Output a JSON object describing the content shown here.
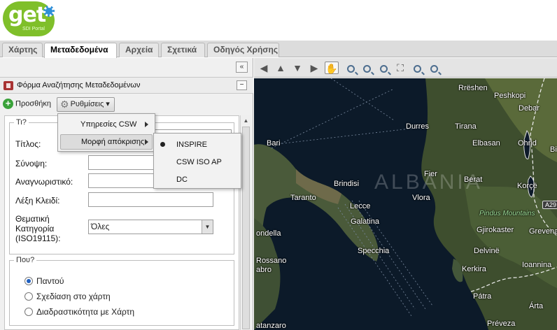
{
  "logo": {
    "text": "get",
    "sub": "SDI Portal"
  },
  "tabs": [
    {
      "label": "Χάρτης",
      "active": false
    },
    {
      "label": "Μεταδεδομένα",
      "active": true
    },
    {
      "label": "Αρχεία",
      "active": false
    },
    {
      "label": "Σχετικά",
      "active": false
    },
    {
      "label": "Οδηγός Χρήσης",
      "active": false
    }
  ],
  "panel": {
    "collapse_icon": "«",
    "title": "Φόρμα Αναζήτησης Μεταδεδομένων",
    "minimize_icon": "−",
    "add_label": "Προσθήκη",
    "settings_label": "Ρυθμίσεις ▾"
  },
  "settings_menu": {
    "items": [
      "Υπηρεσίες CSW",
      "Μορφή απόκρισης"
    ],
    "highlighted": 1
  },
  "response_format_menu": {
    "items": [
      "INSPIRE",
      "CSW ISO AP",
      "DC"
    ],
    "selected": 0
  },
  "what_section": {
    "legend": "Τι?",
    "fields": {
      "title_label": "Τίτλος:",
      "abstract_label": "Σύνοψη:",
      "identifier_label": "Αναγνωριστικό:",
      "keyword_label": "Λέξη Κλειδί:",
      "category_label_1": "Θεματική",
      "category_label_2": "Κατηγορία",
      "category_label_3": "(ISO19115):",
      "category_value": "Όλες",
      "title_value": "",
      "abstract_value": "",
      "identifier_value": "",
      "keyword_value": ""
    }
  },
  "where_section": {
    "legend": "Που?",
    "options": [
      "Παντού",
      "Σχεδίαση στο χάρτη",
      "Διαδραστικότητα με Χάρτη"
    ],
    "selected": 0
  },
  "map": {
    "labels": {
      "rreshen": "Rrëshen",
      "peshkopi": "Peshkopi",
      "debar": "Debar",
      "durres": "Durres",
      "tirana": "Tirana",
      "bari": "Bari",
      "elbasan": "Elbasan",
      "ohrid": "Ohrid",
      "bitola": "Bi",
      "fier": "Fier",
      "berat": "Berat",
      "brindisi": "Brindisi",
      "albania": "ALBANIA",
      "korce": "Korçë",
      "taranto": "Taranto",
      "lecce": "Lecce",
      "vlora": "Vlora",
      "pindus": "Pindus Mountains",
      "a29": "A29",
      "galatina": "Galatina",
      "gjirokaster": "Gjirokaster",
      "grevena": "Grevena",
      "condella": "ondella",
      "specchia": "Specchia",
      "delvine": "Delvinë",
      "rossano": "Rossano",
      "cabro": "abro",
      "kerkira": "Kerkira",
      "ioannina": "Ioannina",
      "patra": "Pátra",
      "arta": "Árta",
      "catanzaro": "atanzaro",
      "preveza": "Préveza"
    }
  }
}
